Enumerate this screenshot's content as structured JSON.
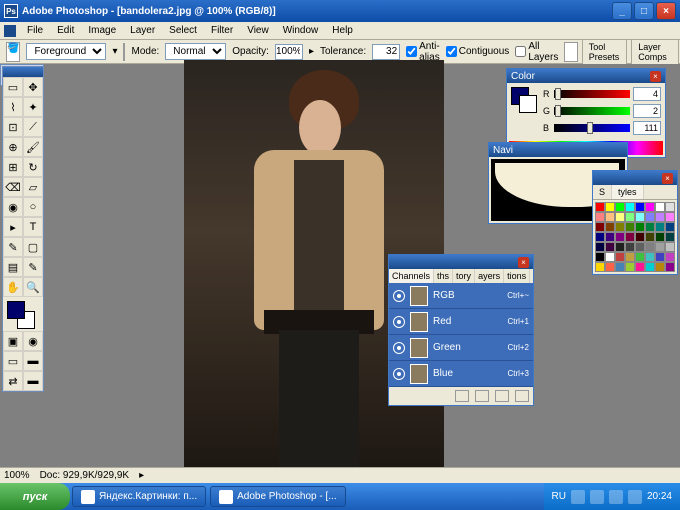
{
  "titlebar": {
    "title": "Adobe Photoshop - [bandolera2.jpg @ 100% (RGB/8)]"
  },
  "menu": {
    "items": [
      "File",
      "Edit",
      "Image",
      "Layer",
      "Select",
      "Filter",
      "View",
      "Window",
      "Help"
    ]
  },
  "options": {
    "fill_label": "Foreground",
    "mode_label": "Mode:",
    "mode_value": "Normal",
    "opacity_label": "Opacity:",
    "opacity_value": "100%",
    "tolerance_label": "Tolerance:",
    "tolerance_value": "32",
    "antialias": "Anti-alias",
    "contiguous": "Contiguous",
    "alllayers": "All Layers",
    "tool_presets": "Tool Presets",
    "layer_comps": "Layer Comps"
  },
  "status": {
    "zoom": "100%",
    "doc": "Doc: 929,9K/929,9K"
  },
  "color_panel": {
    "title": "Color",
    "r_label": "R",
    "r_value": "4",
    "g_label": "G",
    "g_value": "2",
    "b_label": "B",
    "b_value": "111"
  },
  "nav_panel": {
    "title": "Navi"
  },
  "swatches_panel": {
    "tab1": "S",
    "tab2": "tyles"
  },
  "channels_panel": {
    "tabs": [
      "Channels",
      "ths",
      "tory",
      "ayers",
      "tions"
    ],
    "rows": [
      {
        "name": "RGB",
        "shortcut": "Ctrl+~"
      },
      {
        "name": "Red",
        "shortcut": "Ctrl+1"
      },
      {
        "name": "Green",
        "shortcut": "Ctrl+2"
      },
      {
        "name": "Blue",
        "shortcut": "Ctrl+3"
      }
    ]
  },
  "taskbar": {
    "start": "пуск",
    "task1": "Яндекс.Картинки: п...",
    "task2": "Adobe Photoshop - [...",
    "lang": "RU",
    "time": "20:24"
  },
  "swatch_colors": [
    "#ff0000",
    "#ffff00",
    "#00ff00",
    "#00ffff",
    "#0000ff",
    "#ff00ff",
    "#ffffff",
    "#e0e0e0",
    "#ff8080",
    "#ffc080",
    "#ffff80",
    "#80ff80",
    "#80ffff",
    "#8080ff",
    "#c080ff",
    "#ff80ff",
    "#800000",
    "#804000",
    "#808000",
    "#408000",
    "#008000",
    "#008040",
    "#008080",
    "#004080",
    "#000080",
    "#400080",
    "#800080",
    "#800040",
    "#400000",
    "#404000",
    "#004000",
    "#004040",
    "#000040",
    "#400040",
    "#202020",
    "#404040",
    "#606060",
    "#808080",
    "#a0a0a0",
    "#c0c0c0",
    "#000000",
    "#ffffff",
    "#c04040",
    "#c0a040",
    "#40c040",
    "#40c0c0",
    "#4040c0",
    "#c040c0",
    "#ffd700",
    "#ff6347",
    "#4682b4",
    "#9acd32",
    "#ff1493",
    "#00ced1",
    "#b8860b",
    "#8b008b"
  ]
}
